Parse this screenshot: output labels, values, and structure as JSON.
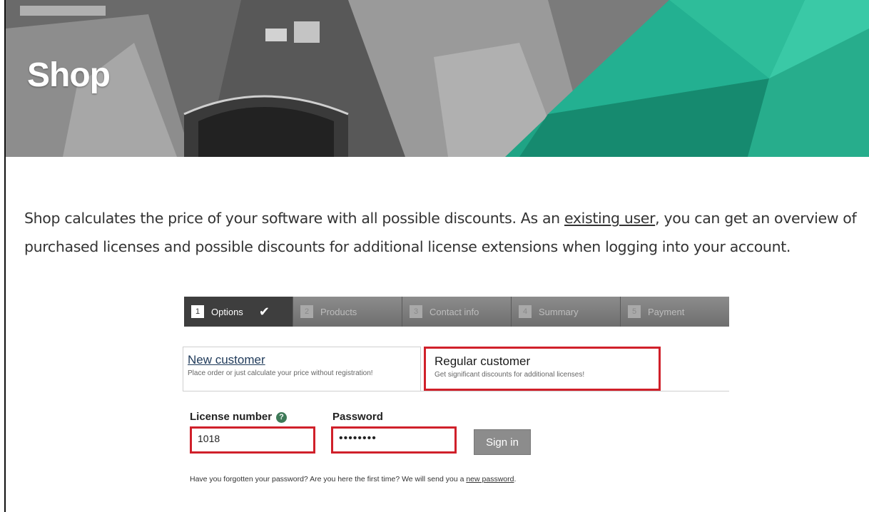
{
  "hero": {
    "title": "Shop"
  },
  "intro": {
    "text_before_link": "Shop calculates the price of your software with all possible discounts. As an ",
    "link_text": "existing user",
    "text_after_link": ", you can get an overview of purchased licenses and possible discounts for additional license extensions when logging into your account."
  },
  "steps": [
    {
      "num": "1",
      "label": "Options",
      "state": "active"
    },
    {
      "num": "2",
      "label": "Products",
      "state": "inactive"
    },
    {
      "num": "3",
      "label": "Contact info",
      "state": "inactive"
    },
    {
      "num": "4",
      "label": "Summary",
      "state": "inactive"
    },
    {
      "num": "5",
      "label": "Payment",
      "state": "inactive"
    }
  ],
  "tabs": {
    "new": {
      "title": "New customer",
      "desc": "Place order or just calculate your price without registration!"
    },
    "regular": {
      "title": "Regular customer",
      "desc": "Get significant discounts for additional licenses!"
    }
  },
  "form": {
    "license_label": "License number",
    "help_icon": "?",
    "password_label": "Password",
    "license_value": "1018",
    "password_value": "••••••••",
    "signin_label": "Sign in",
    "forgot_text": "Have you forgotten your password? Are you here the first time? We will send you a ",
    "forgot_link": "new password",
    "forgot_end": "."
  },
  "colors": {
    "highlight": "#d0202a",
    "teal": "#2aa889",
    "step_active": "#3e3e3e"
  }
}
